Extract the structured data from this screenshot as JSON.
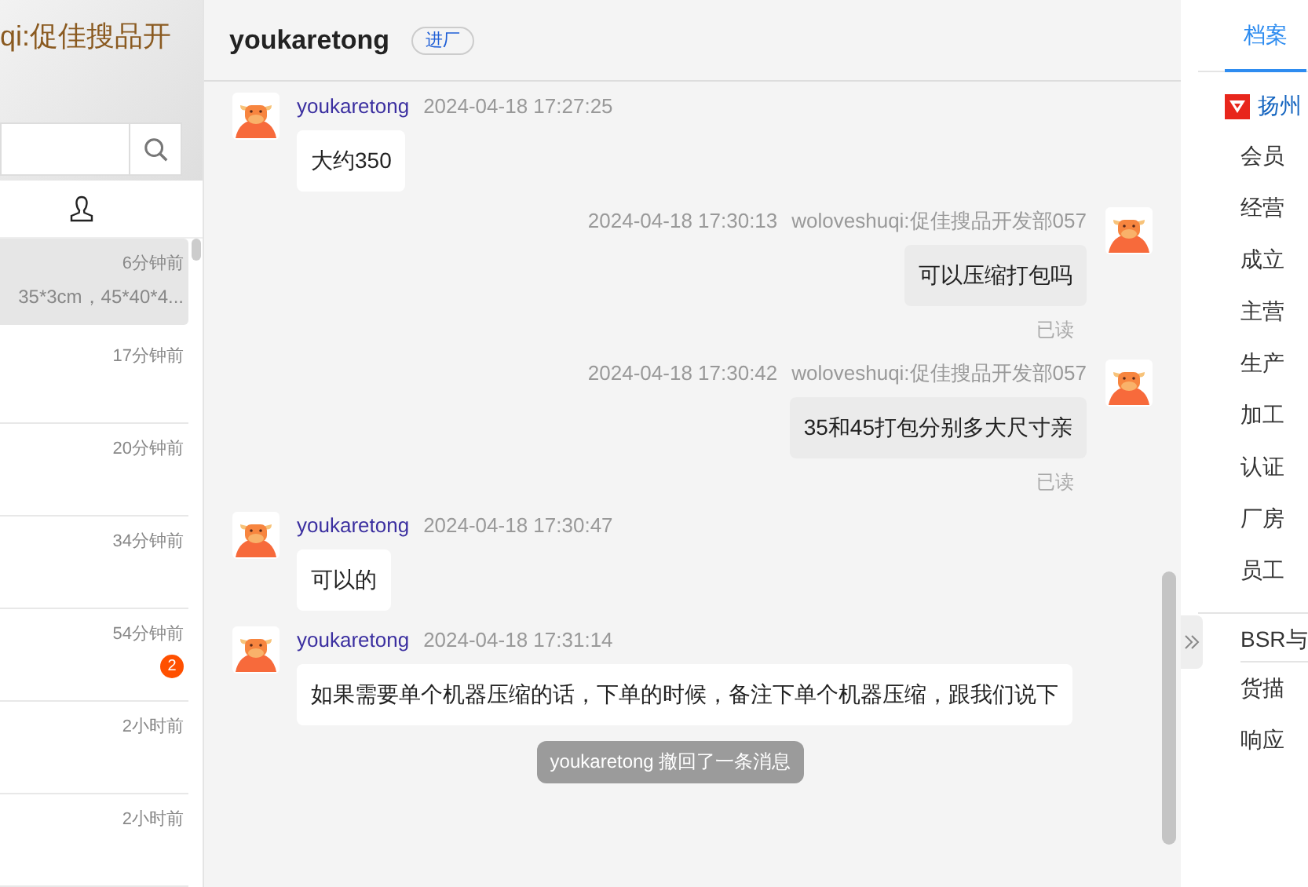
{
  "sidebar": {
    "title": "qi:促佳搜品开",
    "conversations": [
      {
        "time": "6分钟前",
        "preview": "35*3cm，45*40*4...",
        "selected": true
      },
      {
        "time": "17分钟前",
        "selected": false
      },
      {
        "time": "20分钟前",
        "selected": false
      },
      {
        "time": "34分钟前",
        "selected": false
      },
      {
        "time": "54分钟前",
        "unread": "2",
        "selected": false
      },
      {
        "time": "2小时前",
        "selected": false
      },
      {
        "time": "2小时前",
        "selected": false
      }
    ]
  },
  "chat": {
    "title": "youkaretong",
    "tag": "进厂",
    "messages": [
      {
        "kind": "incoming",
        "sender": "youkaretong",
        "time": "2024-04-18 17:27:25",
        "text": "大约350"
      },
      {
        "kind": "outgoing",
        "sender": "woloveshuqi:促佳搜品开发部057",
        "time": "2024-04-18 17:30:13",
        "text": "可以压缩打包吗",
        "status": "已读"
      },
      {
        "kind": "outgoing",
        "sender": "woloveshuqi:促佳搜品开发部057",
        "time": "2024-04-18 17:30:42",
        "text": "35和45打包分别多大尺寸亲",
        "status": "已读"
      },
      {
        "kind": "incoming",
        "sender": "youkaretong",
        "time": "2024-04-18 17:30:47",
        "text": "可以的"
      },
      {
        "kind": "incoming",
        "sender": "youkaretong",
        "time": "2024-04-18 17:31:14",
        "text": "如果需要单个机器压缩的话，下单的时候，备注下单个机器压缩，跟我们说下"
      },
      {
        "kind": "notice",
        "text": "youkaretong 撤回了一条消息"
      }
    ]
  },
  "profile": {
    "tabs": [
      {
        "label": "档案",
        "selected": true
      }
    ],
    "company": "扬州",
    "fields": [
      "会员",
      "经营",
      "成立",
      "主营",
      "生产",
      "加工",
      "认证",
      "厂房",
      "员工"
    ],
    "section": "BSR与",
    "stats": [
      "货描",
      "响应"
    ]
  }
}
